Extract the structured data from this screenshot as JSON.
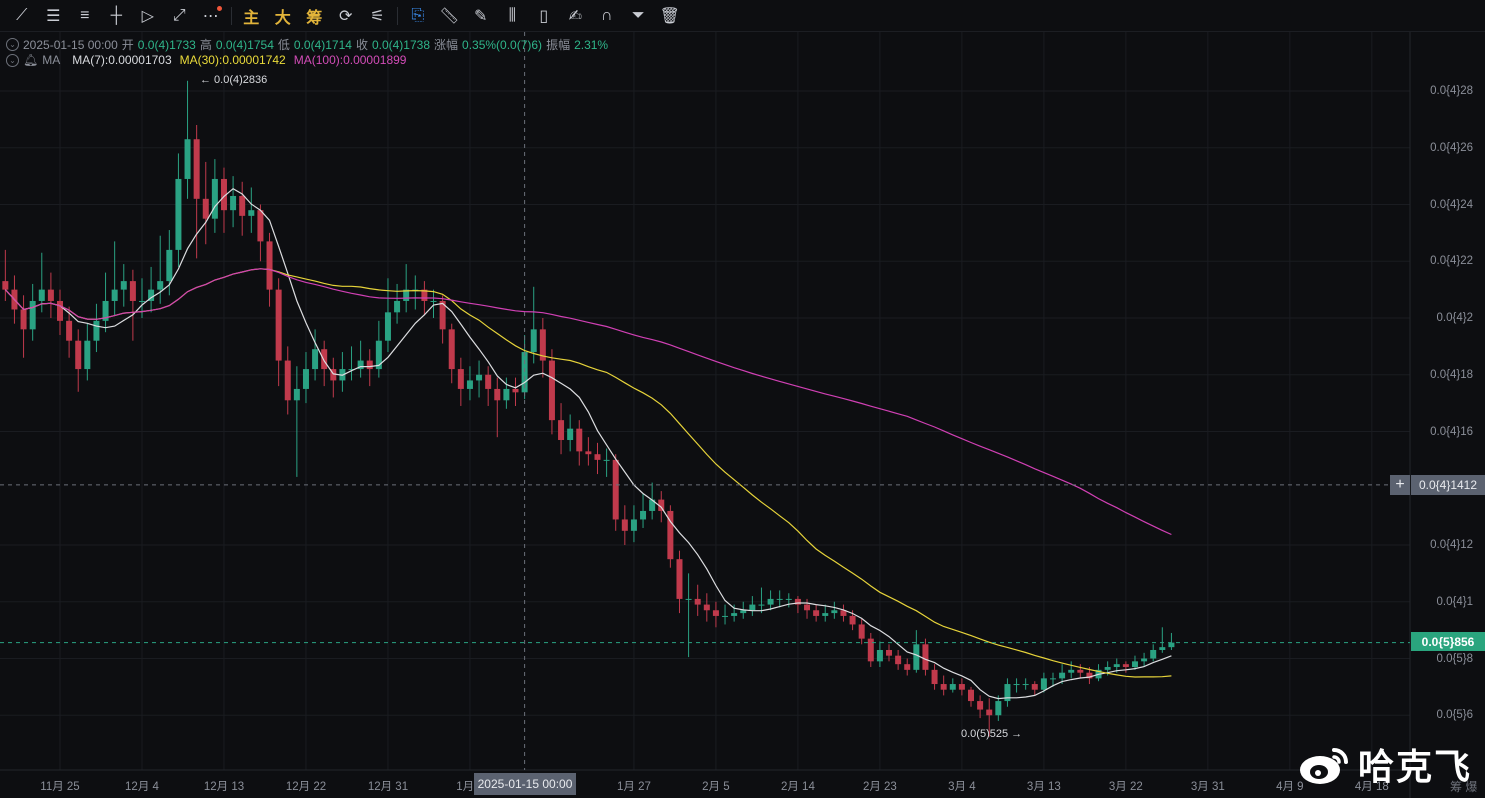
{
  "toolbar": {
    "icons": [
      "trend-line-icon",
      "horizontal-lines-icon",
      "channel-lines-icon",
      "crosshair-line-icon",
      "fib-fan-icon",
      "ray-icon",
      "more-icon"
    ],
    "gold_buttons": [
      "主",
      "大",
      "筹"
    ],
    "icons2": [
      "replay-icon",
      "indicator-settings-icon"
    ],
    "icons3": [
      "bookmark-icon",
      "ruler-icon",
      "brush-icon",
      "candle-type-icon",
      "lock-icon",
      "note-icon",
      "magnet-icon",
      "filter-icon",
      "trash-icon"
    ]
  },
  "ohlc_bar": {
    "date": "2025-01-15 00:00",
    "open_label": "开",
    "open": "0.0(4)1733",
    "high_label": "高",
    "high": "0.0(4)1754",
    "low_label": "低",
    "low": "0.0(4)1714",
    "close_label": "收",
    "close": "0.0(4)1738",
    "change_label": "涨幅",
    "change": "0.35%(0.0(7)6)",
    "amp_label": "振幅",
    "amp": "2.31%"
  },
  "ma_bar": {
    "label": "MA",
    "ma7": "MA(7):0.00001703",
    "ma30": "MA(30):0.00001742",
    "ma100": "MA(100):0.00001899"
  },
  "colors": {
    "up": "#2aa283",
    "down": "#c03a4c",
    "ma7": "#dcdde0",
    "ma30": "#e6d33a",
    "ma100": "#d040b4",
    "background": "#0d0e11"
  },
  "annotations": {
    "high": "← 0.0(4)2836",
    "low": "0.0(5)525 →"
  },
  "crosshair": {
    "date_label": "2025-01-15 00:00",
    "price_label": "0.0{4}1412",
    "price": 1.412e-05,
    "date": "2025-01-15"
  },
  "last_price": {
    "label": "0.0{5}856",
    "value": 8.56e-06
  },
  "watermark": {
    "text": "哈克飞",
    "logo": "weibo-logo"
  },
  "corner": "筹 爆",
  "chart_data": {
    "type": "candlestick",
    "title": "",
    "price_axis": {
      "range": [
        4.9e-06,
        3.02e-05
      ],
      "ticks": [
        {
          "label": "0.0{4}28",
          "value": 2.8e-05
        },
        {
          "label": "0.0{4}26",
          "value": 2.6e-05
        },
        {
          "label": "0.0{4}24",
          "value": 2.4e-05
        },
        {
          "label": "0.0{4}22",
          "value": 2.2e-05
        },
        {
          "label": "0.0{4}2",
          "value": 2e-05
        },
        {
          "label": "0.0{4}18",
          "value": 1.8e-05
        },
        {
          "label": "0.0{4}16",
          "value": 1.6e-05
        },
        {
          "label": "0.0{4}12",
          "value": 1.2e-05
        },
        {
          "label": "0.0{4}1",
          "value": 1e-05
        },
        {
          "label": "0.0{5}8",
          "value": 8e-06
        },
        {
          "label": "0.0{5}6",
          "value": 6e-06
        }
      ]
    },
    "time_axis": {
      "ticks": [
        {
          "label": "11月 25",
          "date": "2024-11-25"
        },
        {
          "label": "12月 4",
          "date": "2024-12-04"
        },
        {
          "label": "12月 13",
          "date": "2024-12-13"
        },
        {
          "label": "12月 22",
          "date": "2024-12-22"
        },
        {
          "label": "12月 31",
          "date": "2024-12-31"
        },
        {
          "label": "1月 9",
          "date": "2025-01-09"
        },
        {
          "label": "1月 27",
          "date": "2025-01-27"
        },
        {
          "label": "2月 5",
          "date": "2025-02-05"
        },
        {
          "label": "2月 14",
          "date": "2025-02-14"
        },
        {
          "label": "2月 23",
          "date": "2025-02-23"
        },
        {
          "label": "3月 4",
          "date": "2025-03-04"
        },
        {
          "label": "3月 13",
          "date": "2025-03-13"
        },
        {
          "label": "3月 22",
          "date": "2025-03-22"
        },
        {
          "label": "3月 31",
          "date": "2025-03-31"
        },
        {
          "label": "4月 9",
          "date": "2025-04-09"
        },
        {
          "label": "4月 18",
          "date": "2025-04-18"
        }
      ]
    },
    "grid": true,
    "indicators": [
      "MA7",
      "MA30",
      "MA100"
    ],
    "candles": [
      [
        "2024-11-19",
        2.13e-05,
        2.24e-05,
        2.06e-05,
        2.1e-05
      ],
      [
        "2024-11-20",
        2.1e-05,
        2.15e-05,
        1.98e-05,
        2.03e-05
      ],
      [
        "2024-11-21",
        2.03e-05,
        2.08e-05,
        1.86e-05,
        1.96e-05
      ],
      [
        "2024-11-22",
        1.96e-05,
        2.12e-05,
        1.92e-05,
        2.06e-05
      ],
      [
        "2024-11-23",
        2.06e-05,
        2.23e-05,
        2.02e-05,
        2.1e-05
      ],
      [
        "2024-11-24",
        2.1e-05,
        2.16e-05,
        2e-05,
        2.06e-05
      ],
      [
        "2024-11-25",
        2.06e-05,
        2.1e-05,
        1.94e-05,
        1.99e-05
      ],
      [
        "2024-11-26",
        1.99e-05,
        2.04e-05,
        1.86e-05,
        1.92e-05
      ],
      [
        "2024-11-27",
        1.92e-05,
        1.96e-05,
        1.74e-05,
        1.82e-05
      ],
      [
        "2024-11-28",
        1.82e-05,
        1.98e-05,
        1.78e-05,
        1.92e-05
      ],
      [
        "2024-11-29",
        1.92e-05,
        2.05e-05,
        1.88e-05,
        1.99e-05
      ],
      [
        "2024-11-30",
        1.99e-05,
        2.16e-05,
        1.95e-05,
        2.06e-05
      ],
      [
        "2024-12-01",
        2.06e-05,
        2.27e-05,
        2.01e-05,
        2.1e-05
      ],
      [
        "2024-12-02",
        2.1e-05,
        2.19e-05,
        2.04e-05,
        2.13e-05
      ],
      [
        "2024-12-03",
        2.13e-05,
        2.17e-05,
        1.92e-05,
        2.06e-05
      ],
      [
        "2024-12-04",
        2.06e-05,
        2.14e-05,
        2e-05,
        2.06e-05
      ],
      [
        "2024-12-05",
        2.06e-05,
        2.18e-05,
        2.02e-05,
        2.1e-05
      ],
      [
        "2024-12-06",
        2.1e-05,
        2.29e-05,
        2.05e-05,
        2.13e-05
      ],
      [
        "2024-12-07",
        2.13e-05,
        2.31e-05,
        2.08e-05,
        2.24e-05
      ],
      [
        "2024-12-08",
        2.24e-05,
        2.58e-05,
        2.18e-05,
        2.49e-05
      ],
      [
        "2024-12-09",
        2.49e-05,
        2.836e-05,
        2.42e-05,
        2.63e-05
      ],
      [
        "2024-12-10",
        2.63e-05,
        2.68e-05,
        2.21e-05,
        2.42e-05
      ],
      [
        "2024-12-11",
        2.42e-05,
        2.55e-05,
        2.26e-05,
        2.35e-05
      ],
      [
        "2024-12-12",
        2.35e-05,
        2.56e-05,
        2.3e-05,
        2.49e-05
      ],
      [
        "2024-12-13",
        2.49e-05,
        2.53e-05,
        2.3e-05,
        2.38e-05
      ],
      [
        "2024-12-14",
        2.38e-05,
        2.5e-05,
        2.32e-05,
        2.43e-05
      ],
      [
        "2024-12-15",
        2.43e-05,
        2.48e-05,
        2.29e-05,
        2.36e-05
      ],
      [
        "2024-12-16",
        2.36e-05,
        2.46e-05,
        2.3e-05,
        2.38e-05
      ],
      [
        "2024-12-17",
        2.38e-05,
        2.4e-05,
        2.2e-05,
        2.27e-05
      ],
      [
        "2024-12-18",
        2.27e-05,
        2.3e-05,
        2.04e-05,
        2.1e-05
      ],
      [
        "2024-12-19",
        2.1e-05,
        2.14e-05,
        1.76e-05,
        1.85e-05
      ],
      [
        "2024-12-20",
        1.85e-05,
        1.9e-05,
        1.66e-05,
        1.71e-05
      ],
      [
        "2024-12-21",
        1.71e-05,
        1.83e-05,
        1.44e-05,
        1.75e-05
      ],
      [
        "2024-12-22",
        1.75e-05,
        1.88e-05,
        1.7e-05,
        1.82e-05
      ],
      [
        "2024-12-23",
        1.82e-05,
        1.96e-05,
        1.78e-05,
        1.89e-05
      ],
      [
        "2024-12-24",
        1.89e-05,
        1.92e-05,
        1.76e-05,
        1.82e-05
      ],
      [
        "2024-12-25",
        1.82e-05,
        1.86e-05,
        1.72e-05,
        1.78e-05
      ],
      [
        "2024-12-26",
        1.78e-05,
        1.88e-05,
        1.74e-05,
        1.82e-05
      ],
      [
        "2024-12-27",
        1.82e-05,
        1.9e-05,
        1.78e-05,
        1.82e-05
      ],
      [
        "2024-12-28",
        1.82e-05,
        1.92e-05,
        1.79e-05,
        1.85e-05
      ],
      [
        "2024-12-29",
        1.85e-05,
        1.89e-05,
        1.76e-05,
        1.82e-05
      ],
      [
        "2024-12-30",
        1.82e-05,
        1.99e-05,
        1.79e-05,
        1.92e-05
      ],
      [
        "2024-12-31",
        1.92e-05,
        2.14e-05,
        1.88e-05,
        2.02e-05
      ],
      [
        "2025-01-01",
        2.02e-05,
        2.12e-05,
        1.98e-05,
        2.06e-05
      ],
      [
        "2025-01-02",
        2.06e-05,
        2.19e-05,
        2.02e-05,
        2.1e-05
      ],
      [
        "2025-01-03",
        2.1e-05,
        2.15e-05,
        2.03e-05,
        2.1e-05
      ],
      [
        "2025-01-04",
        2.1e-05,
        2.13e-05,
        2.01e-05,
        2.06e-05
      ],
      [
        "2025-01-05",
        2.06e-05,
        2.1e-05,
        2e-05,
        2.06e-05
      ],
      [
        "2025-01-06",
        2.06e-05,
        2.08e-05,
        1.91e-05,
        1.96e-05
      ],
      [
        "2025-01-07",
        1.96e-05,
        1.98e-05,
        1.77e-05,
        1.82e-05
      ],
      [
        "2025-01-08",
        1.82e-05,
        1.86e-05,
        1.69e-05,
        1.75e-05
      ],
      [
        "2025-01-09",
        1.75e-05,
        1.83e-05,
        1.71e-05,
        1.78e-05
      ],
      [
        "2025-01-10",
        1.78e-05,
        1.85e-05,
        1.72e-05,
        1.8e-05
      ],
      [
        "2025-01-11",
        1.8e-05,
        1.83e-05,
        1.69e-05,
        1.75e-05
      ],
      [
        "2025-01-12",
        1.75e-05,
        1.79e-05,
        1.58e-05,
        1.71e-05
      ],
      [
        "2025-01-13",
        1.71e-05,
        1.79e-05,
        1.68e-05,
        1.75e-05
      ],
      [
        "2025-01-14",
        1.75e-05,
        1.79e-05,
        1.69e-05,
        1.738e-05
      ],
      [
        "2025-01-15",
        1.738e-05,
        1.94e-05,
        1.714e-05,
        1.88e-05
      ],
      [
        "2025-01-16",
        1.88e-05,
        2.11e-05,
        1.84e-05,
        1.96e-05
      ],
      [
        "2025-01-17",
        1.96e-05,
        2e-05,
        1.79e-05,
        1.85e-05
      ],
      [
        "2025-01-18",
        1.85e-05,
        1.89e-05,
        1.59e-05,
        1.64e-05
      ],
      [
        "2025-01-19",
        1.64e-05,
        1.7e-05,
        1.52e-05,
        1.57e-05
      ],
      [
        "2025-01-20",
        1.57e-05,
        1.66e-05,
        1.53e-05,
        1.61e-05
      ],
      [
        "2025-01-21",
        1.61e-05,
        1.64e-05,
        1.48e-05,
        1.53e-05
      ],
      [
        "2025-01-22",
        1.53e-05,
        1.58e-05,
        1.48e-05,
        1.52e-05
      ],
      [
        "2025-01-23",
        1.52e-05,
        1.56e-05,
        1.45e-05,
        1.5e-05
      ],
      [
        "2025-01-24",
        1.5e-05,
        1.54e-05,
        1.44e-05,
        1.5e-05
      ],
      [
        "2025-01-25",
        1.5e-05,
        1.52e-05,
        1.25e-05,
        1.29e-05
      ],
      [
        "2025-01-26",
        1.29e-05,
        1.34e-05,
        1.2e-05,
        1.25e-05
      ],
      [
        "2025-01-27",
        1.25e-05,
        1.34e-05,
        1.21e-05,
        1.29e-05
      ],
      [
        "2025-01-28",
        1.29e-05,
        1.38e-05,
        1.26e-05,
        1.32e-05
      ],
      [
        "2025-01-29",
        1.32e-05,
        1.42e-05,
        1.29e-05,
        1.36e-05
      ],
      [
        "2025-01-30",
        1.36e-05,
        1.39e-05,
        1.28e-05,
        1.32e-05
      ],
      [
        "2025-01-31",
        1.32e-05,
        1.34e-05,
        1.12e-05,
        1.15e-05
      ],
      [
        "2025-02-01",
        1.15e-05,
        1.18e-05,
        9.6e-06,
        1.01e-05
      ],
      [
        "2025-02-02",
        1.01e-05,
        1.1e-05,
        8.05e-06,
        1.01e-05
      ],
      [
        "2025-02-03",
        1.01e-05,
        1.06e-05,
        9.5e-06,
        9.9e-06
      ],
      [
        "2025-02-04",
        9.9e-06,
        1.03e-05,
        9.3e-06,
        9.7e-06
      ],
      [
        "2025-02-05",
        9.7e-06,
        1e-05,
        9.1e-06,
        9.5e-06
      ],
      [
        "2025-02-06",
        9.5e-06,
        9.9e-06,
        9.2e-06,
        9.5e-06
      ],
      [
        "2025-02-07",
        9.5e-06,
        9.9e-06,
        9.3e-06,
        9.6e-06
      ],
      [
        "2025-02-08",
        9.6e-06,
        1e-05,
        9.4e-06,
        9.7e-06
      ],
      [
        "2025-02-09",
        9.7e-06,
        1.02e-05,
        9.5e-06,
        9.9e-06
      ],
      [
        "2025-02-10",
        9.9e-06,
        1.05e-05,
        9.6e-06,
        9.9e-06
      ],
      [
        "2025-02-11",
        9.9e-06,
        1.04e-05,
        9.7e-06,
        1.01e-05
      ],
      [
        "2025-02-12",
        1.01e-05,
        1.04e-05,
        9.8e-06,
        1.01e-05
      ],
      [
        "2025-02-13",
        1.01e-05,
        1.03e-05,
        9.8e-06,
        1.01e-05
      ],
      [
        "2025-02-14",
        1.01e-05,
        1.02e-05,
        9.6e-06,
        9.9e-06
      ],
      [
        "2025-02-15",
        9.9e-06,
        1.01e-05,
        9.4e-06,
        9.7e-06
      ],
      [
        "2025-02-16",
        9.7e-06,
        9.9e-06,
        9.3e-06,
        9.5e-06
      ],
      [
        "2025-02-17",
        9.5e-06,
        9.9e-06,
        9.3e-06,
        9.6e-06
      ],
      [
        "2025-02-18",
        9.6e-06,
        1e-05,
        9.4e-06,
        9.7e-06
      ],
      [
        "2025-02-19",
        9.7e-06,
        9.9e-06,
        9.3e-06,
        9.5e-06
      ],
      [
        "2025-02-20",
        9.5e-06,
        9.7e-06,
        9e-06,
        9.2e-06
      ],
      [
        "2025-02-21",
        9.2e-06,
        9.4e-06,
        8.5e-06,
        8.7e-06
      ],
      [
        "2025-02-22",
        8.7e-06,
        8.9e-06,
        7.7e-06,
        7.9e-06
      ],
      [
        "2025-02-23",
        7.9e-06,
        8.6e-06,
        7.7e-06,
        8.3e-06
      ],
      [
        "2025-02-24",
        8.3e-06,
        8.5e-06,
        7.9e-06,
        8.1e-06
      ],
      [
        "2025-02-25",
        8.1e-06,
        8.3e-06,
        7.6e-06,
        7.8e-06
      ],
      [
        "2025-02-26",
        7.8e-06,
        8e-06,
        7.4e-06,
        7.6e-06
      ],
      [
        "2025-02-27",
        7.6e-06,
        9e-06,
        7.5e-06,
        8.5e-06
      ],
      [
        "2025-02-28",
        8.5e-06,
        8.7e-06,
        7.4e-06,
        7.6e-06
      ],
      [
        "2025-03-01",
        7.6e-06,
        7.8e-06,
        6.9e-06,
        7.1e-06
      ],
      [
        "2025-03-02",
        7.1e-06,
        7.4e-06,
        6.7e-06,
        6.9e-06
      ],
      [
        "2025-03-03",
        6.9e-06,
        7.3e-06,
        6.8e-06,
        7.1e-06
      ],
      [
        "2025-03-04",
        7.1e-06,
        7.3e-06,
        6.7e-06,
        6.9e-06
      ],
      [
        "2025-03-05",
        6.9e-06,
        7e-06,
        6.3e-06,
        6.5e-06
      ],
      [
        "2025-03-06",
        6.5e-06,
        6.7e-06,
        5.9e-06,
        6.2e-06
      ],
      [
        "2025-03-07",
        6.2e-06,
        6.6e-06,
        5.25e-06,
        6e-06
      ],
      [
        "2025-03-08",
        6e-06,
        6.7e-06,
        5.8e-06,
        6.5e-06
      ],
      [
        "2025-03-09",
        6.5e-06,
        7.3e-06,
        6.3e-06,
        7.1e-06
      ],
      [
        "2025-03-10",
        7.1e-06,
        7.3e-06,
        6.8e-06,
        7.1e-06
      ],
      [
        "2025-03-11",
        7.1e-06,
        7.3e-06,
        6.9e-06,
        7.1e-06
      ],
      [
        "2025-03-12",
        7.1e-06,
        7.2e-06,
        6.7e-06,
        6.9e-06
      ],
      [
        "2025-03-13",
        6.9e-06,
        7.5e-06,
        6.8e-06,
        7.3e-06
      ],
      [
        "2025-03-14",
        7.3e-06,
        7.5e-06,
        7e-06,
        7.3e-06
      ],
      [
        "2025-03-15",
        7.3e-06,
        7.8e-06,
        7.1e-06,
        7.5e-06
      ],
      [
        "2025-03-16",
        7.5e-06,
        7.9e-06,
        7.3e-06,
        7.6e-06
      ],
      [
        "2025-03-17",
        7.6e-06,
        7.8e-06,
        7.3e-06,
        7.5e-06
      ],
      [
        "2025-03-18",
        7.5e-06,
        7.7e-06,
        7.1e-06,
        7.3e-06
      ],
      [
        "2025-03-19",
        7.3e-06,
        7.8e-06,
        7.2e-06,
        7.6e-06
      ],
      [
        "2025-03-20",
        7.6e-06,
        7.9e-06,
        7.4e-06,
        7.7e-06
      ],
      [
        "2025-03-21",
        7.7e-06,
        8e-06,
        7.5e-06,
        7.8e-06
      ],
      [
        "2025-03-22",
        7.8e-06,
        7.9e-06,
        7.5e-06,
        7.7e-06
      ],
      [
        "2025-03-23",
        7.7e-06,
        8.1e-06,
        7.6e-06,
        7.9e-06
      ],
      [
        "2025-03-24",
        7.9e-06,
        8.2e-06,
        7.7e-06,
        8e-06
      ],
      [
        "2025-03-25",
        8e-06,
        8.5e-06,
        7.9e-06,
        8.3e-06
      ],
      [
        "2025-03-26",
        8.3e-06,
        9.1e-06,
        8.2e-06,
        8.4e-06
      ],
      [
        "2025-03-27",
        8.4e-06,
        8.9e-06,
        8.3e-06,
        8.56e-06
      ]
    ]
  }
}
